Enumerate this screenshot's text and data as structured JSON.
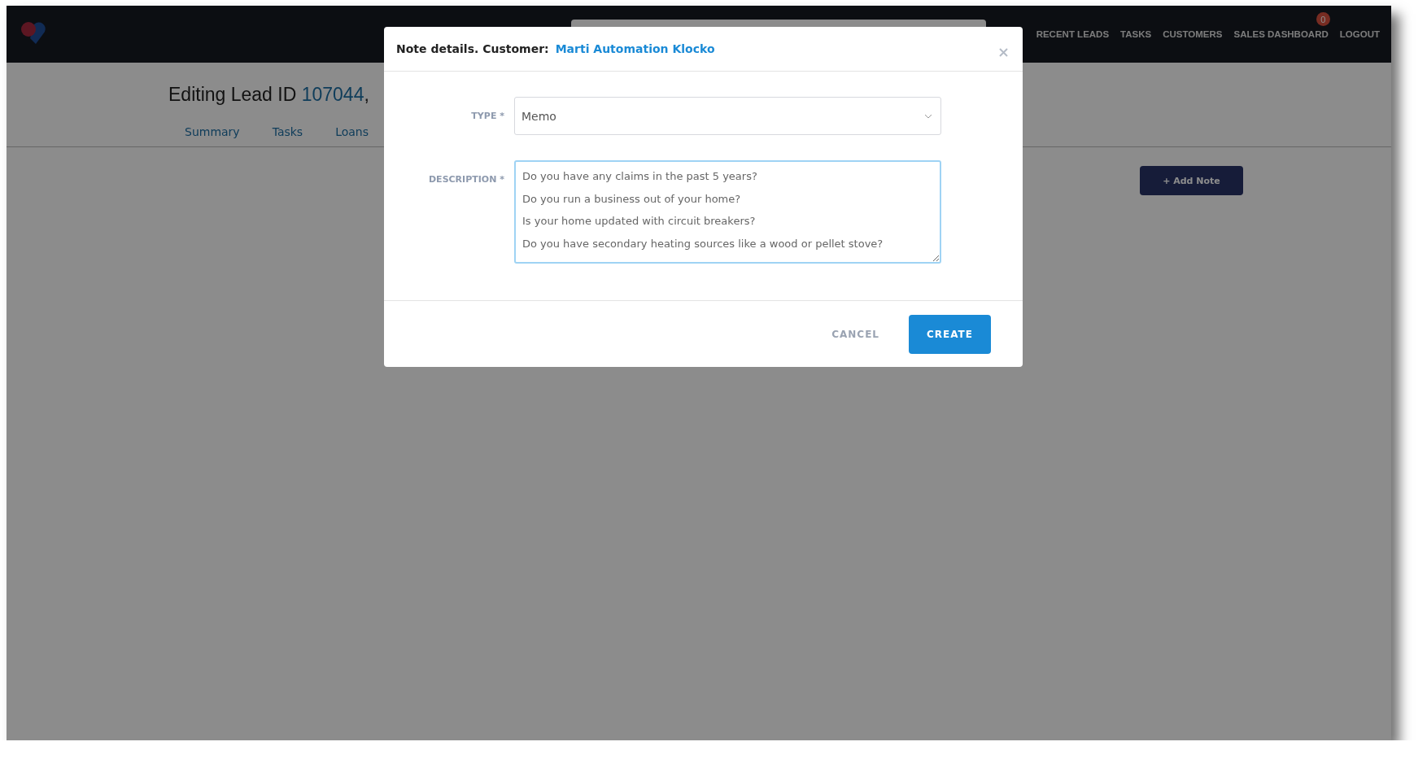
{
  "navbar": {
    "links": [
      {
        "label": "RECENT LEADS"
      },
      {
        "label": "TASKS"
      },
      {
        "label": "CUSTOMERS"
      },
      {
        "label": "SALES DASHBOARD",
        "badge": "0"
      },
      {
        "label": "LOGOUT"
      }
    ]
  },
  "page": {
    "title_prefix": "Editing Lead ID",
    "lead_id": "107044",
    "title_suffix": ",",
    "tabs": [
      {
        "label": "Summary"
      },
      {
        "label": "Tasks"
      },
      {
        "label": "Loans"
      }
    ],
    "add_note_button": "+ Add Note"
  },
  "modal": {
    "title": "Note details. Customer:",
    "customer": "Marti Automation Klocko",
    "type_label": "TYPE *",
    "type_value": "Memo",
    "description_label": "DESCRIPTION *",
    "description_lines": [
      "Do you have any claims in the past 5 years?",
      "Do you run a business out of your home?",
      "Is your home updated with circuit breakers?",
      "Do you have secondary heating sources like a wood or pellet stove?"
    ],
    "cancel_button": "CANCEL",
    "create_button": "CREATE"
  }
}
